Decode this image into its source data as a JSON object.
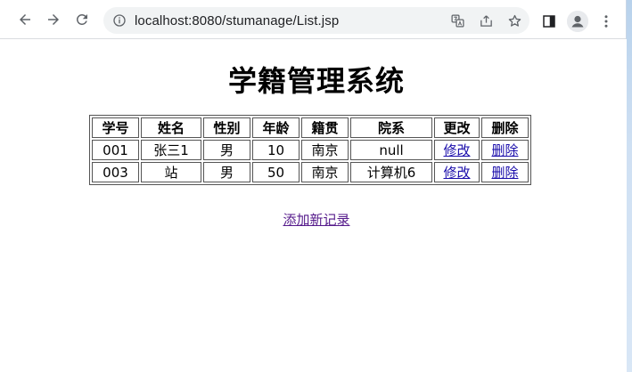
{
  "browser": {
    "url": "localhost:8080/stumanage/List.jsp"
  },
  "page": {
    "title": "学籍管理系统",
    "columns": [
      "学号",
      "姓名",
      "性别",
      "年龄",
      "籍贯",
      "院系",
      "更改",
      "删除"
    ],
    "rows": [
      {
        "id": "001",
        "name": "张三1",
        "gender": "男",
        "age": "10",
        "origin": "南京",
        "dept": "null",
        "edit": "修改",
        "delete": "删除"
      },
      {
        "id": "003",
        "name": "站",
        "gender": "男",
        "age": "50",
        "origin": "南京",
        "dept": "计算机6",
        "edit": "修改",
        "delete": "删除"
      }
    ],
    "add_link": "添加新记录"
  },
  "icons": {
    "back": "arrow-left-icon",
    "forward": "arrow-right-icon",
    "reload": "reload-icon",
    "info": "info-icon",
    "translate": "translate-icon",
    "share": "share-icon",
    "bookmark": "star-icon",
    "side_panel": "side-panel-icon",
    "profile": "profile-icon",
    "menu": "kebab-menu-icon"
  },
  "colors": {
    "link": "#1a0dab",
    "visited_link": "#551a8b",
    "desktop_background": "#cfe0f3"
  }
}
